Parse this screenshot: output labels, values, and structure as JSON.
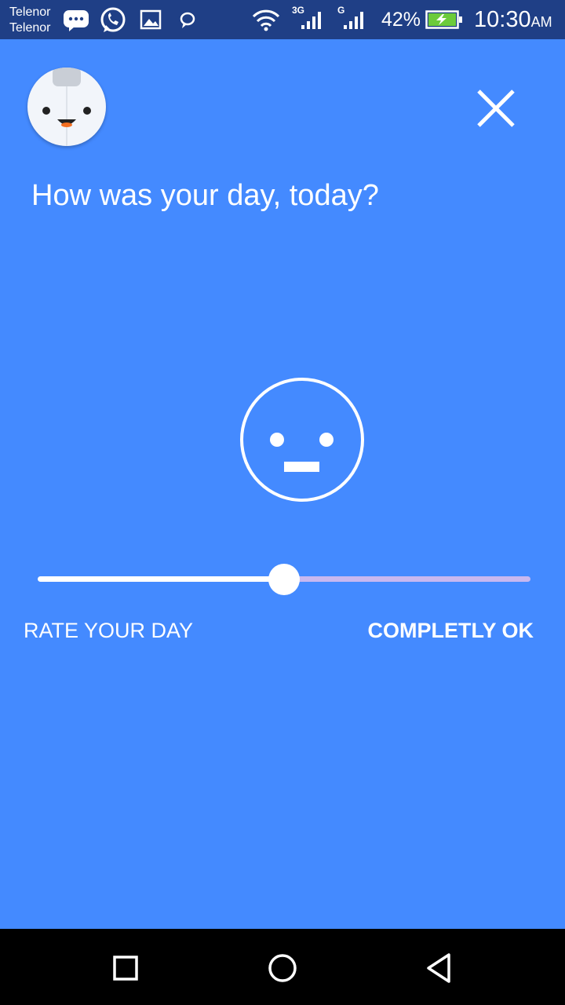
{
  "status_bar": {
    "carrier_1": "Telenor",
    "carrier_2": "Telenor",
    "network_1": "3G",
    "network_2": "G",
    "battery": "42%",
    "time": "10:30",
    "ampm": "AM"
  },
  "main": {
    "question": "How was your day, today?",
    "rate_label": "RATE YOUR DAY",
    "rating_value": "COMPLETLY OK",
    "slider_fraction": 0.5
  },
  "colors": {
    "background": "#448aff",
    "status_bar": "#1f3f86",
    "track_rest": "#c8b8f0"
  },
  "icons": {
    "close": "close-icon",
    "mood": "neutral-face-icon",
    "avatar": "robot-avatar-icon"
  }
}
